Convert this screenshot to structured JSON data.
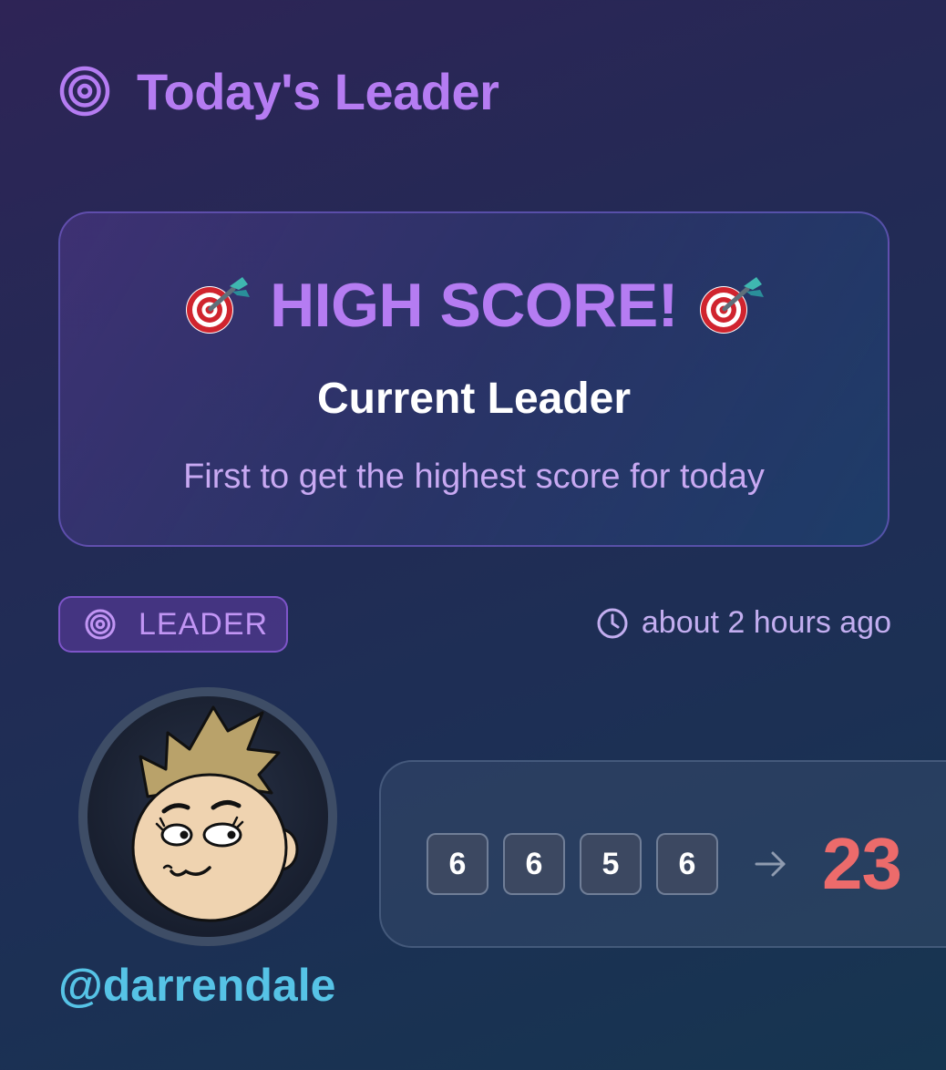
{
  "header": {
    "title": "Today's Leader",
    "icon": "target-icon"
  },
  "score_card": {
    "headline": "HIGH SCORE!",
    "headline_icon": "direct-hit-dart-icon",
    "title": "Current Leader",
    "subtitle": "First to get the highest score for today"
  },
  "badge": {
    "label": "LEADER",
    "icon": "target-icon"
  },
  "timestamp": {
    "text": "about 2 hours ago",
    "icon": "clock-icon"
  },
  "user": {
    "username": "@darrendale",
    "avatar": "cartoon-avatar"
  },
  "roll": {
    "dice": [
      "6",
      "6",
      "5",
      "6"
    ],
    "arrow_icon": "arrow-right-icon",
    "total": "23"
  },
  "colors": {
    "accent_purple": "#b57cf2",
    "username_blue": "#56c3e6",
    "total_red": "#ec6b6b",
    "background_top": "#2e2456",
    "background_bottom": "#163550"
  }
}
